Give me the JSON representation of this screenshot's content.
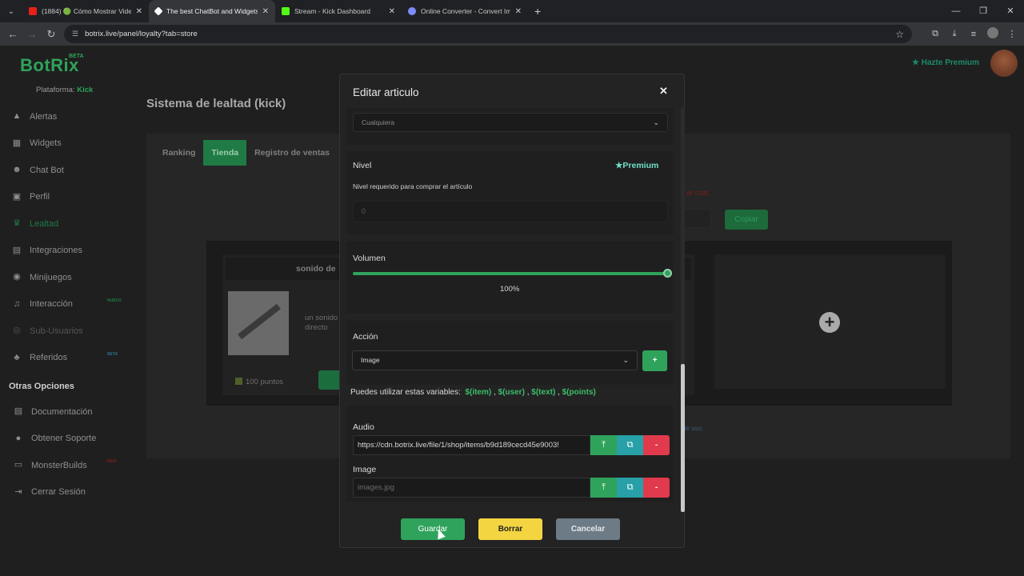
{
  "browser": {
    "tabs": [
      {
        "title": "(1884) 🟢 Cómo Mostrar Videos",
        "favicon_color": "#e62117"
      },
      {
        "title": "The best ChatBot and Widgets f",
        "favicon_color": "#ffffff"
      },
      {
        "title": "Stream - Kick Dashboard",
        "favicon_color": "#53fc18"
      },
      {
        "title": "Online Converter - Convert Ima",
        "favicon_color": "#7b8cff"
      }
    ],
    "url": "botrix.live/panel/loyalty?tab=store"
  },
  "app": {
    "logo": "BotRix",
    "logo_badge": "BETA",
    "platform_label": "Plataforma:",
    "platform_value": "Kick",
    "premium_link": "Hazte Premium"
  },
  "sidebar": {
    "items": [
      {
        "label": "Alertas",
        "icon": "warning-icon",
        "glyph": "▲"
      },
      {
        "label": "Widgets",
        "icon": "grid-icon",
        "glyph": "▦"
      },
      {
        "label": "Chat Bot",
        "icon": "bot-icon",
        "glyph": "☻"
      },
      {
        "label": "Perfil",
        "icon": "profile-icon",
        "glyph": "▣"
      },
      {
        "label": "Lealtad",
        "icon": "trophy-icon",
        "glyph": "♛"
      },
      {
        "label": "Integraciones",
        "icon": "integration-icon",
        "glyph": "▤"
      },
      {
        "label": "Minijuegos",
        "icon": "gamepad-icon",
        "glyph": "◉"
      },
      {
        "label": "Interacción",
        "icon": "music-icon",
        "glyph": "♫",
        "badge": "NUEVO",
        "badge_color": "#1f7a44"
      },
      {
        "label": "Sub-Usuarios",
        "icon": "sub-users-icon",
        "glyph": "◎"
      },
      {
        "label": "Referidos",
        "icon": "users-icon",
        "glyph": "♣",
        "badge": "BETA",
        "badge_color": "#27708a"
      }
    ],
    "section_title": "Otras Opciones",
    "other_items": [
      {
        "label": "Documentación",
        "icon": "document-icon",
        "glyph": "▤"
      },
      {
        "label": "Obtener Soporte",
        "icon": "support-icon",
        "glyph": "●"
      },
      {
        "label": "MonsterBuilds",
        "icon": "monitor-icon",
        "glyph": "▭",
        "badge": "NEW",
        "badge_color": "#7a1f1f"
      },
      {
        "label": "Cerrar Sesión",
        "icon": "logout-icon",
        "glyph": "⇥"
      }
    ]
  },
  "page": {
    "title": "Sistema de lealtad (kick)",
    "tabs": [
      "Ranking",
      "Tienda",
      "Registro de ventas"
    ],
    "red_link": "...el chat",
    "copy_button": "Copiar",
    "item_title": "sonido de",
    "item_description": "un sonido directo",
    "item_points": "100 puntos",
    "terms_link": "de uso."
  },
  "modal": {
    "title": "Editar articulo",
    "top_select_value": "Cualquiera",
    "level_label": "Nivel",
    "premium_badge": "Premium",
    "level_help": "Nivel requerido para comprar el artículo",
    "level_placeholder": "0",
    "volume_label": "Volumen",
    "volume_value": "100%",
    "volume_level": 1.0,
    "action_label": "Acción",
    "action_value": "Image",
    "add_action_button": "+",
    "vars_text": "Puedes utilizar estas variables:",
    "variables": [
      "$(item)",
      "$(user)",
      "$(text)",
      "$(points)"
    ],
    "audio_label": "Audio",
    "audio_value": "https://cdn.botrix.live/file/1/shop/items/b9d189cecd45e9003!",
    "image_label": "Image",
    "image_placeholder": "images.jpg",
    "remove_label": "-",
    "save_button": "Guardar",
    "delete_button": "Borrar",
    "cancel_button": "Cancelar"
  }
}
